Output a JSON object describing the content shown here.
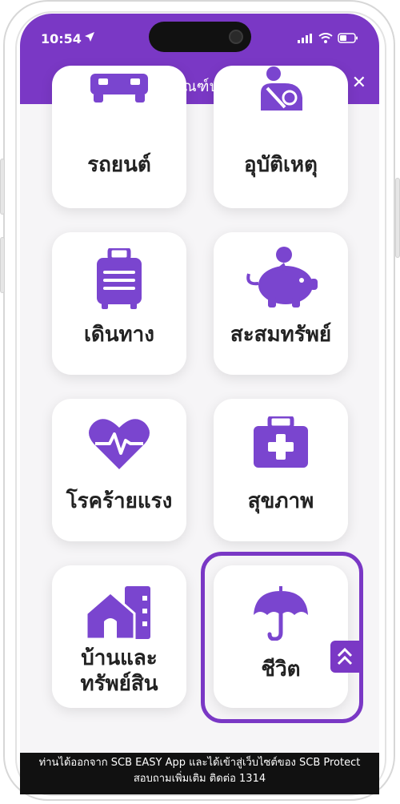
{
  "status": {
    "time": "10:54"
  },
  "header": {
    "title": "ผลิตภัณฑ์ประกัน",
    "close_label": "✕"
  },
  "products": [
    {
      "label": "รถยนต์",
      "icon": "car-icon"
    },
    {
      "label": "อุบัติเหตุ",
      "icon": "accident-icon"
    },
    {
      "label": "เดินทาง",
      "icon": "luggage-icon"
    },
    {
      "label": "สะสมทรัพย์",
      "icon": "piggy-bank-icon"
    },
    {
      "label": "โรคร้ายแรง",
      "icon": "heartbeat-icon"
    },
    {
      "label": "สุขภาพ",
      "icon": "medical-kit-icon"
    },
    {
      "label_line1": "บ้านและ",
      "label_line2": "ทรัพย์สิน",
      "icon": "house-icon"
    },
    {
      "label": "ชีวิต",
      "icon": "umbrella-icon",
      "selected": true
    }
  ],
  "banner": {
    "line1": "ท่านได้ออกจาก SCB EASY App และได้เข้าสู่เว็บไซต์ของ SCB Protect",
    "line2": "สอบถามเพิ่มเติม ติดต่อ 1314"
  },
  "colors": {
    "accent": "#7a38c5",
    "icon": "#7a45cf"
  }
}
